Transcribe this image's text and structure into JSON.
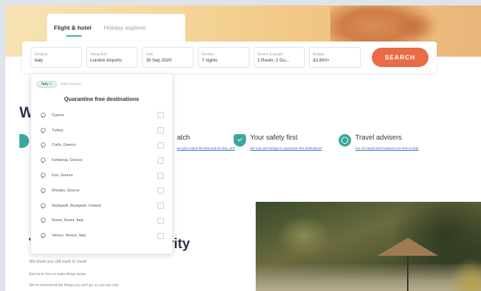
{
  "tabs": [
    {
      "label": "Flight & hotel",
      "active": true
    },
    {
      "label": "Holiday explorer",
      "active": false
    }
  ],
  "search": {
    "fields": [
      {
        "label": "Going to",
        "value": "Italy"
      },
      {
        "label": "Flying from",
        "value": "London Airports"
      },
      {
        "label": "Date",
        "value": "30 Sep 2020"
      },
      {
        "label": "Duration",
        "value": "7 nights"
      },
      {
        "label": "Rooms & people",
        "value": "1 Room, 2 Gu..."
      },
      {
        "label": "Budget",
        "value": "£2,600+"
      }
    ],
    "button_label": "SEARCH"
  },
  "dropdown": {
    "chip": "Italy ×",
    "add_placeholder": "Add location",
    "title": "Quarantine free destinations",
    "items": [
      "Cyprus",
      "Turkey",
      "Corfu, Greece",
      "Kefalonia, Greece",
      "Kos, Greece",
      "Rhodes, Greece",
      "Reykjavik, Reykjavik, Iceland",
      "Rome, Rome, Italy",
      "Venice, Venice, Italy"
    ]
  },
  "page": {
    "heading_start": "W",
    "heading_end": "iority",
    "features": [
      {
        "title": "atch",
        "link": "we price match the best deal for less, we'll",
        "icon": "globe-icon"
      },
      {
        "title": "Your safety first",
        "link": "We only sell holidays to quarantine free destinations",
        "icon": "shield-icon"
      },
      {
        "title": "Travel advisers",
        "link": "Our UK based travel advisers are here to help",
        "icon": "globe-icon"
      }
    ],
    "paragraphs": [
      "We know you still want to travel",
      "And we're here to make things easier.",
      "We've removed all the things you can't go, so you can only"
    ]
  },
  "colors": {
    "accent": "#3aa99a",
    "button": "#ea6b45",
    "text": "#2c3345"
  }
}
